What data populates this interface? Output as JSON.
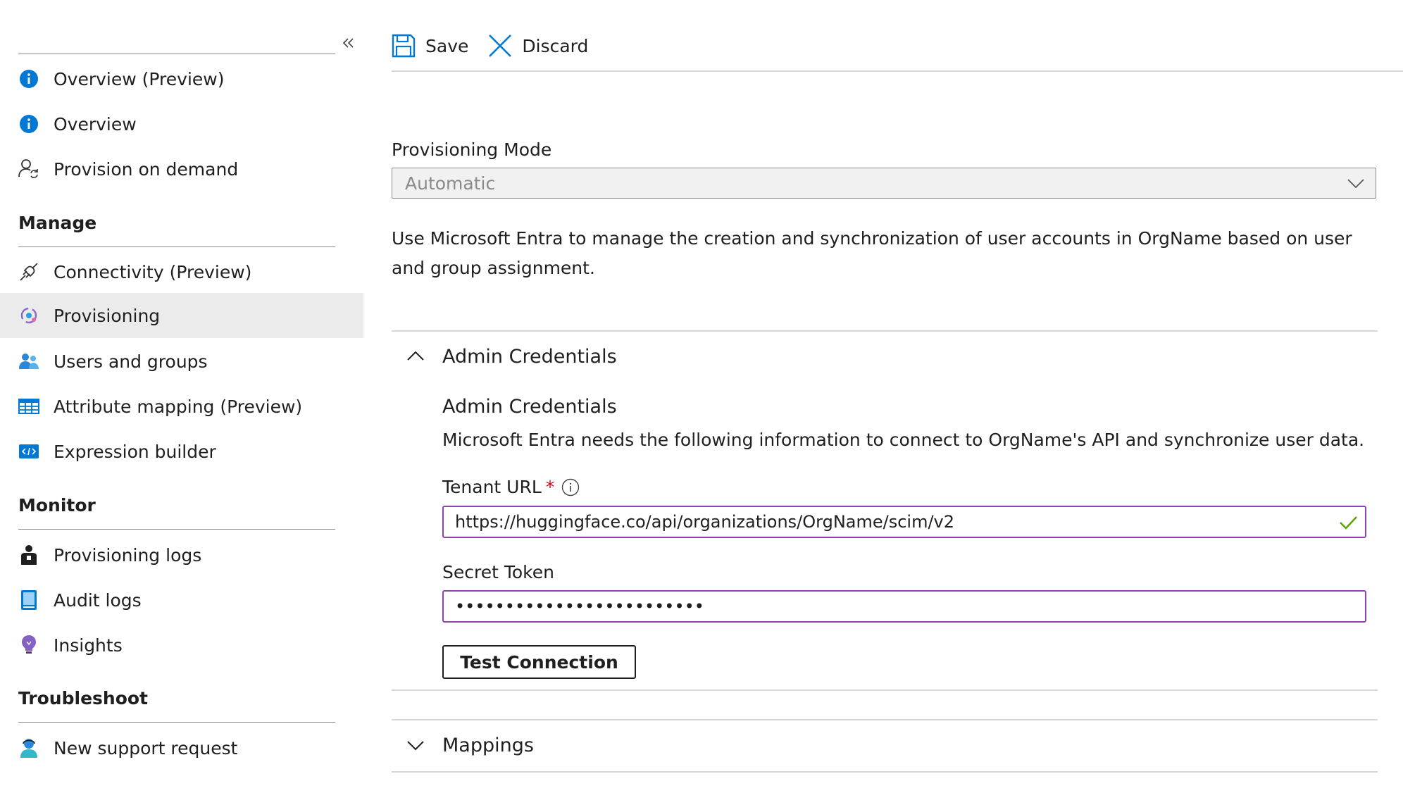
{
  "sidebar": {
    "collapse_icon": "double-chevron-left-icon",
    "items_top": [
      {
        "label": "Overview (Preview)",
        "icon": "info-icon"
      },
      {
        "label": "Overview",
        "icon": "info-icon"
      },
      {
        "label": "Provision on demand",
        "icon": "user-sync-icon"
      }
    ],
    "sections": [
      {
        "title": "Manage",
        "items": [
          {
            "label": "Connectivity (Preview)",
            "icon": "plug-icon"
          },
          {
            "label": "Provisioning",
            "icon": "provisioning-icon",
            "active": true
          },
          {
            "label": "Users and groups",
            "icon": "users-icon"
          },
          {
            "label": "Attribute mapping (Preview)",
            "icon": "table-icon"
          },
          {
            "label": "Expression builder",
            "icon": "code-icon"
          }
        ]
      },
      {
        "title": "Monitor",
        "items": [
          {
            "label": "Provisioning logs",
            "icon": "person-log-icon"
          },
          {
            "label": "Audit logs",
            "icon": "book-icon"
          },
          {
            "label": "Insights",
            "icon": "lightbulb-icon"
          }
        ]
      },
      {
        "title": "Troubleshoot",
        "items": [
          {
            "label": "New support request",
            "icon": "support-icon"
          }
        ]
      }
    ]
  },
  "toolbar": {
    "save_label": "Save",
    "discard_label": "Discard"
  },
  "main": {
    "provisioning_mode_label": "Provisioning Mode",
    "provisioning_mode_value": "Automatic",
    "description": "Use Microsoft Entra to manage the creation and synchronization of user accounts in OrgName based on user and group assignment.",
    "admin_credentials": {
      "header": "Admin Credentials",
      "title": "Admin Credentials",
      "description": "Microsoft Entra needs the following information to connect to OrgName's API and synchronize user data.",
      "tenant_url_label": "Tenant URL",
      "required_marker": "*",
      "tenant_url_value": "https://huggingface.co/api/organizations/OrgName/scim/v2",
      "secret_token_label": "Secret Token",
      "secret_token_value": "•••••••••••••••••••••••••",
      "test_button": "Test Connection"
    },
    "mappings_header": "Mappings"
  },
  "colors": {
    "input_border": "#8e44ad",
    "active_nav_bg": "#ebebeb",
    "accent_blue": "#0078d4",
    "required_red": "#c50f1f",
    "check_green": "#57a300"
  }
}
